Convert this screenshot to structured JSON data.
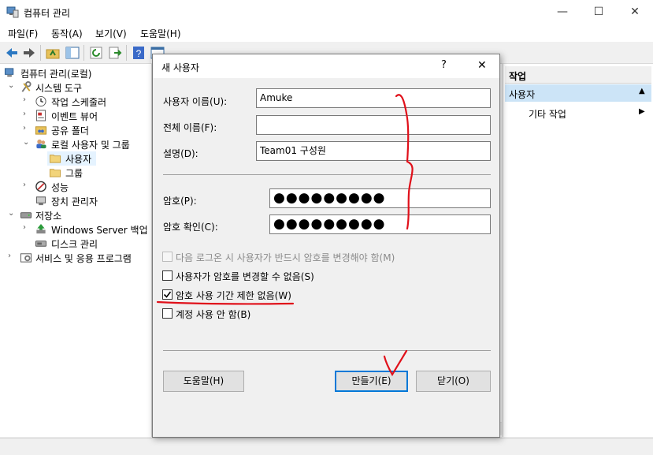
{
  "window": {
    "title": "컴퓨터 관리",
    "controls": {
      "minimize": "—",
      "maximize": "☐",
      "close": "✕"
    }
  },
  "menu": [
    "파일(F)",
    "동작(A)",
    "보기(V)",
    "도움말(H)"
  ],
  "tree": {
    "root": "컴퓨터 관리(로컬)",
    "system_tools": "시스템 도구",
    "task_scheduler": "작업 스케줄러",
    "event_viewer": "이벤트 뷰어",
    "shared_folders": "공유 폴더",
    "local_users_groups": "로컬 사용자 및 그룹",
    "users": "사용자",
    "groups": "그룹",
    "performance": "성능",
    "device_manager": "장치 관리자",
    "storage": "저장소",
    "windows_server_backup": "Windows Server 백업",
    "disk_management": "디스크 관리",
    "services_apps": "서비스 및 응용 프로그램"
  },
  "actions": {
    "header": "작업",
    "section": "사용자",
    "more": "기타 작업"
  },
  "dialog": {
    "title": "새 사용자",
    "help_glyph": "?",
    "close_glyph": "✕",
    "username_label": "사용자 이름(U):",
    "username_value": "Amuke",
    "fullname_label": "전체 이름(F):",
    "fullname_value": "",
    "description_label": "설명(D):",
    "description_value": "Team01 구성원",
    "password_label": "암호(P):",
    "password_value": "●●●●●●●●●",
    "confirm_label": "암호 확인(C):",
    "confirm_value": "●●●●●●●●●",
    "options": [
      {
        "label": "다음 로그온 시 사용자가 반드시 암호를 변경해야 함(M)",
        "checked": false,
        "enabled": false
      },
      {
        "label": "사용자가 암호를 변경할 수 없음(S)",
        "checked": false,
        "enabled": true
      },
      {
        "label": "암호 사용 기간 제한 없음(W)",
        "checked": true,
        "enabled": true
      },
      {
        "label": "계정 사용 안 함(B)",
        "checked": false,
        "enabled": true
      }
    ],
    "help_button": "도움말(H)",
    "create_button": "만들기(E)",
    "close_button": "닫기(O)"
  },
  "colors": {
    "annotation": "#e0101a",
    "selection": "#cce4f7",
    "focus": "#0078d7"
  }
}
